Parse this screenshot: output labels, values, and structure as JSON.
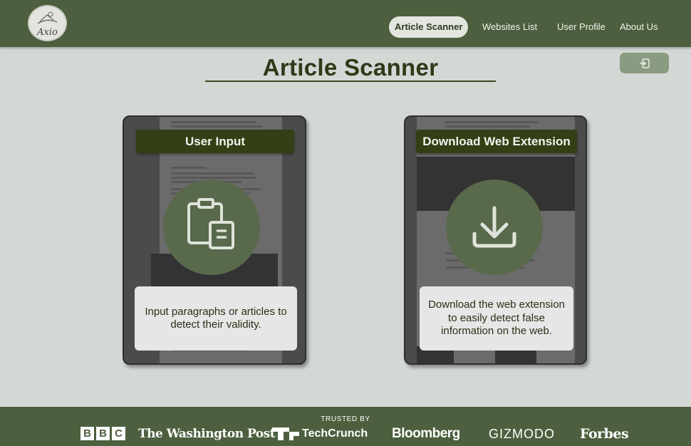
{
  "header": {
    "logo_text": "Axio",
    "nav": [
      {
        "label": "Article Scanner",
        "active": true
      },
      {
        "label": "Websites List",
        "active": false
      },
      {
        "label": "User Profile",
        "active": false
      },
      {
        "label": "About Us",
        "active": false
      }
    ]
  },
  "page": {
    "title": "Article Scanner",
    "logout_icon": "logout-icon"
  },
  "cards": [
    {
      "label": "User Input",
      "icon": "clipboard-icon",
      "description": "Input paragraphs or articles to detect their validity."
    },
    {
      "label": "Download Web Extension",
      "icon": "download-icon",
      "description": "Download the web extension to easily detect false information on the web."
    }
  ],
  "footer": {
    "trusted_label": "TRUSTED BY",
    "brands": [
      "BBC",
      "The Washington Post",
      "TechCrunch",
      "Bloomberg",
      "GIZMODO",
      "Forbes"
    ]
  },
  "colors": {
    "header_bg": "#4d5f3e",
    "page_bg": "#d3d8d5",
    "card_label_bg": "#333f14",
    "circle_bg": "#59694c",
    "title_color": "#2e3a18"
  }
}
